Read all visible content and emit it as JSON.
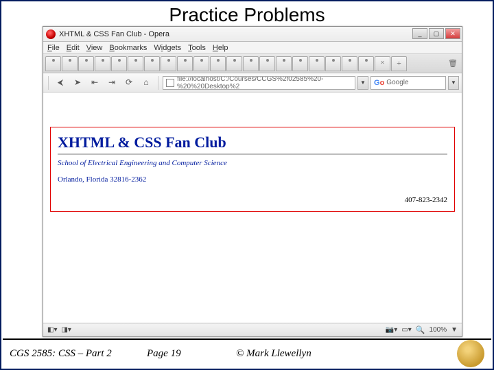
{
  "slide": {
    "title": "Practice Problems"
  },
  "browser": {
    "window_title": "XHTML & CSS Fan Club - Opera",
    "menus": {
      "file": "File",
      "edit": "Edit",
      "view": "View",
      "bookmarks": "Bookmarks",
      "widgets": "Widgets",
      "tools": "Tools",
      "help": "Help"
    },
    "url": "file://localhost/C:/Courses/CCGS%2f02585%20-%20%20Desktop%2",
    "search_placeholder": "Google",
    "zoom": "100%"
  },
  "page": {
    "heading": "XHTML & CSS Fan Club",
    "school": "School of Electrical Engineering and Computer Science",
    "address": "Orlando, Florida 32816-2362",
    "phone": "407-823-2342"
  },
  "footer": {
    "course": "CGS 2585: CSS – Part 2",
    "page": "Page 19",
    "copyright": "© Mark Llewellyn"
  }
}
